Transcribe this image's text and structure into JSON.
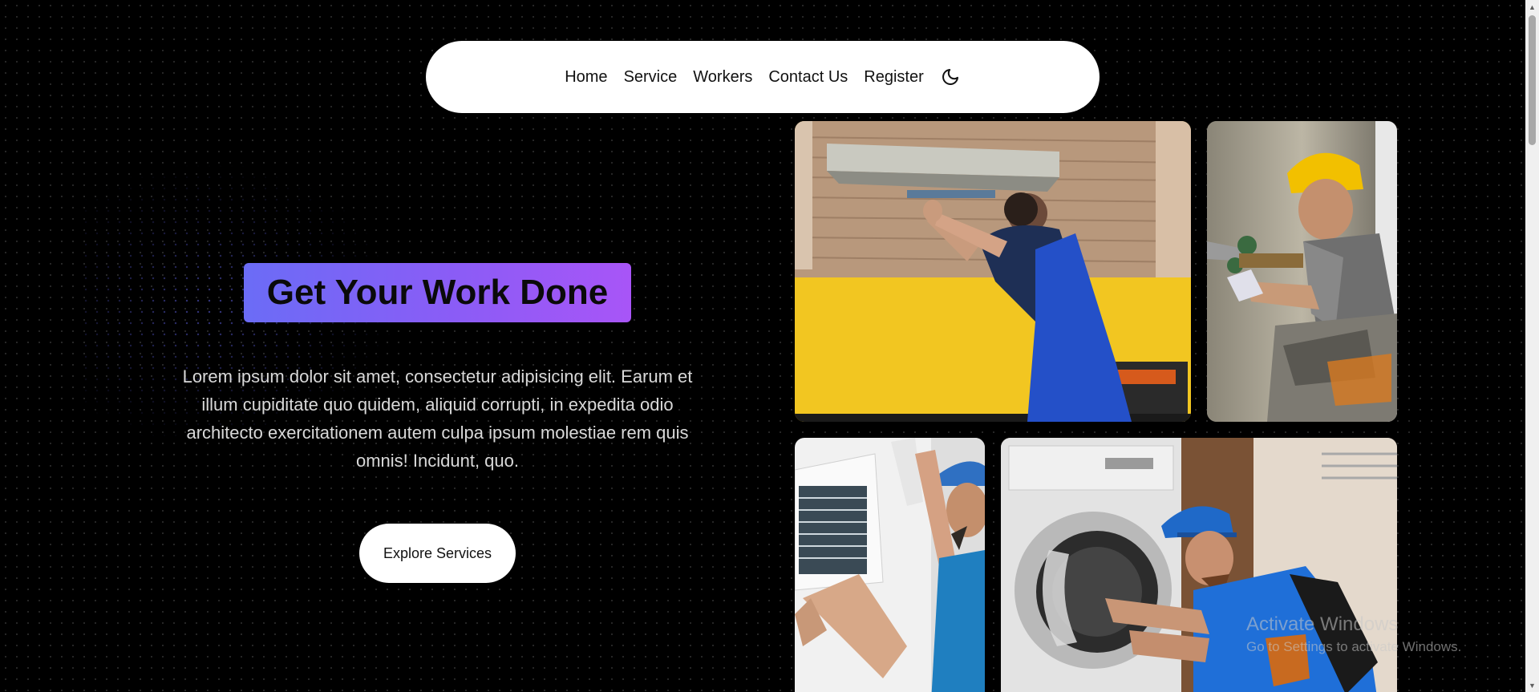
{
  "nav": {
    "links": [
      {
        "label": "Home"
      },
      {
        "label": "Service"
      },
      {
        "label": "Workers"
      },
      {
        "label": "Contact Us"
      },
      {
        "label": "Register"
      }
    ],
    "theme_icon": "moon-icon"
  },
  "hero": {
    "title": "Get Your Work Done",
    "description": "Lorem ipsum dolor sit amet, consectetur adipisicing elit. Earum et illum cupiditate quo quidem, aliquid corrupti, in expedita odio architecto exercitationem autem culpa ipsum molestiae rem quis omnis! Incidunt, quo.",
    "cta_label": "Explore Services"
  },
  "colors": {
    "background": "#000000",
    "title_gradient_start": "#6b6cf6",
    "title_gradient_end": "#a855f7",
    "nav_bg": "#ffffff"
  },
  "gallery": {
    "photos": [
      {
        "subject": "worker-fixing-kitchen-hood"
      },
      {
        "subject": "plumber-with-hard-hat"
      },
      {
        "subject": "technician-fixing-air-conditioner"
      },
      {
        "subject": "repairman-fixing-washing-machine"
      }
    ]
  },
  "watermark": {
    "line1": "Activate Windows",
    "line2": "Go to Settings to activate Windows."
  }
}
